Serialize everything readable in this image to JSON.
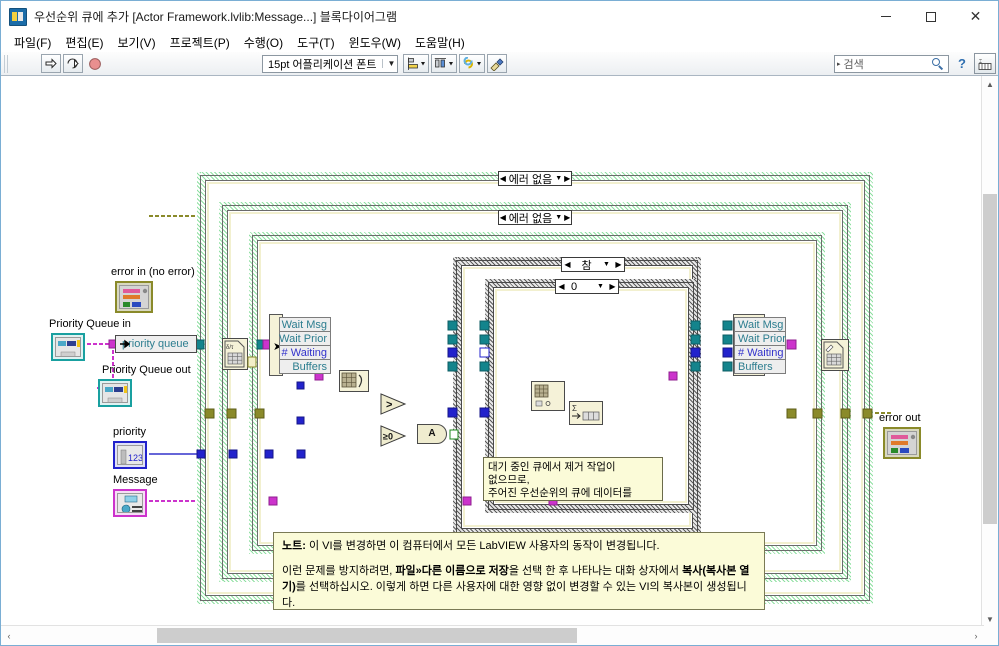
{
  "window": {
    "title": "우선순위 큐에 추가 [Actor Framework.lvlib:Message...] 블록다이어그램",
    "icon": "labview-vi-icon",
    "minimize": "−",
    "maximize": "□",
    "close": "✕"
  },
  "menu": {
    "items": [
      {
        "label": "파일(F)",
        "name": "menu-file"
      },
      {
        "label": "편집(E)",
        "name": "menu-edit"
      },
      {
        "label": "보기(V)",
        "name": "menu-view"
      },
      {
        "label": "프로젝트(P)",
        "name": "menu-project"
      },
      {
        "label": "수행(O)",
        "name": "menu-operate"
      },
      {
        "label": "도구(T)",
        "name": "menu-tools"
      },
      {
        "label": "윈도우(W)",
        "name": "menu-window"
      },
      {
        "label": "도움말(H)",
        "name": "menu-help"
      }
    ]
  },
  "toolbar": {
    "run_arrow": "run-icon",
    "run_continuous": "run-continuous-icon",
    "abort": "abort-icon",
    "font_selector": "15pt 어플리케이션 폰트",
    "font_arrow": "▼",
    "align_objects": "align-objects-icon",
    "distribute_objects": "distribute-objects-icon",
    "resize_objects": "resize-objects-icon",
    "reorder": "reorder-icon",
    "clean_up": "clean-up-diagram-icon",
    "dropdown_arrow": "▼"
  },
  "search": {
    "placeholder": "검색",
    "value": "",
    "left_arrow": "▸",
    "magnifier": "search-icon",
    "help_button": "?",
    "context_help": "context-help-icon"
  },
  "diagram": {
    "structures": [
      {
        "name": "outer-case-structure",
        "selector": "에러 없음",
        "left_arrow": "◀",
        "right_arrow": "▶",
        "dropdown": "▼"
      },
      {
        "name": "second-case-structure",
        "selector": "에러 없음",
        "left_arrow": "◀",
        "right_arrow": "▶",
        "dropdown": "▼"
      },
      {
        "name": "true-case-structure",
        "selector": "참",
        "left_arrow": "◀",
        "right_arrow": "▶",
        "dropdown": "▼"
      },
      {
        "name": "zero-case-structure",
        "selector": "0",
        "left_arrow": "◀",
        "right_arrow": "▶",
        "dropdown": "▼"
      }
    ],
    "terminals": [
      {
        "name": "error-in-terminal",
        "label": "error in (no error)"
      },
      {
        "name": "priority-queue-in-terminal",
        "label": "Priority Queue in"
      },
      {
        "name": "priority-queue-out-terminal",
        "label": "Priority Queue out"
      },
      {
        "name": "priority-terminal",
        "label": "priority"
      },
      {
        "name": "message-terminal",
        "label": "Message"
      },
      {
        "name": "error-out-terminal",
        "label": "error out"
      }
    ],
    "nodes": [
      {
        "name": "priority-queue-label",
        "label": "priority queue"
      }
    ],
    "cluster_left": {
      "name": "unbundle-cluster",
      "items": [
        "Wait Msg",
        "Wait Prior",
        "# Waiting",
        "Buffers"
      ]
    },
    "cluster_right": {
      "name": "bundle-cluster",
      "items": [
        "Wait Msg",
        "Wait Prior",
        "# Waiting",
        "Buffers"
      ]
    },
    "comparison_nodes": [
      {
        "name": "greater-than-node",
        "label": ">"
      },
      {
        "name": "greater-equal-zero-node",
        "label": "≥0"
      },
      {
        "name": "and-node",
        "label": "A"
      }
    ],
    "comment": {
      "name": "diagram-comment",
      "text": "대기 중인 큐에서 제거 작업이\n없으므로,\n주어진 우선순위의 큐에 데이터를\n추가합니다."
    },
    "note": {
      "name": "vi-note-box",
      "line1_bold": "노트:",
      "line1": " 이 VI를 변경하면 이 컴퓨터에서 모든  LabVIEW 사용자의 동작이 변경됩니다.",
      "p2_a": "이런 문제를 방지하려면, ",
      "p2_b": "파일»다른 이름으로 저장",
      "p2_c": "을 선택 한 후 나타나는 대화 상자에서 ",
      "p2_d": "복사(복사본 열기)",
      "p2_e": "를 선택하십시오. 이렇게 하면 다른 사용자에 대한 영향 없이 변경할 수 있는 VI의 복사본이 생성됩니다."
    }
  },
  "scrollbars": {
    "v_up": "▲",
    "v_down": "▼",
    "h_left": "‹",
    "h_right": "›"
  },
  "colors": {
    "error_wire": "#8a8a2a",
    "refnum_wire": "#19a0a0",
    "message_wire": "#cc33cc",
    "numeric_wire": "#3333cc",
    "boolean_wire": "#1e8a1e",
    "cluster_wire": "#2c7d8f",
    "case_green": "#8fe0a2",
    "note_bg": "#fbfbd8"
  }
}
